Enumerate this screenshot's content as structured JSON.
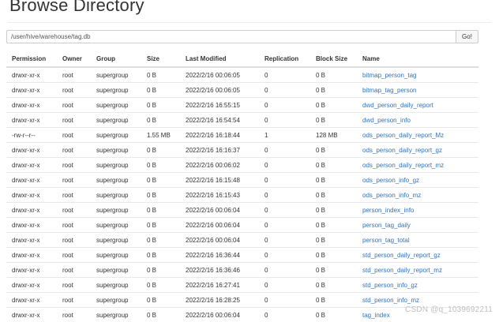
{
  "page": {
    "title": "Browse Directory"
  },
  "path_bar": {
    "value": "/user/hive/warehouse/tag.db",
    "go_label": "Go!"
  },
  "table": {
    "columns": [
      "Permission",
      "Owner",
      "Group",
      "Size",
      "Last Modified",
      "Replication",
      "Block Size",
      "Name"
    ],
    "rows": [
      [
        "drwxr-xr-x",
        "root",
        "supergroup",
        "0 B",
        "2022/2/16 00:06:05",
        "0",
        "0 B",
        "bitmap_person_tag"
      ],
      [
        "drwxr-xr-x",
        "root",
        "supergroup",
        "0 B",
        "2022/2/16 00:06:05",
        "0",
        "0 B",
        "bitmap_tag_person"
      ],
      [
        "drwxr-xr-x",
        "root",
        "supergroup",
        "0 B",
        "2022/2/16 16:55:15",
        "0",
        "0 B",
        "dwd_person_daily_report"
      ],
      [
        "drwxr-xr-x",
        "root",
        "supergroup",
        "0 B",
        "2022/2/16 16:54:54",
        "0",
        "0 B",
        "dwd_person_info"
      ],
      [
        "-rw-r--r--",
        "root",
        "supergroup",
        "1.55 MB",
        "2022/2/16 16:18:44",
        "1",
        "128 MB",
        "ods_person_daily_report_Mz"
      ],
      [
        "drwxr-xr-x",
        "root",
        "supergroup",
        "0 B",
        "2022/2/16 16:16:37",
        "0",
        "0 B",
        "ods_person_daily_report_gz"
      ],
      [
        "drwxr-xr-x",
        "root",
        "supergroup",
        "0 B",
        "2022/2/16 00:06:02",
        "0",
        "0 B",
        "ods_person_daily_report_mz"
      ],
      [
        "drwxr-xr-x",
        "root",
        "supergroup",
        "0 B",
        "2022/2/16 16:15:48",
        "0",
        "0 B",
        "ods_person_info_gz"
      ],
      [
        "drwxr-xr-x",
        "root",
        "supergroup",
        "0 B",
        "2022/2/16 16:15:43",
        "0",
        "0 B",
        "ods_person_info_mz"
      ],
      [
        "drwxr-xr-x",
        "root",
        "supergroup",
        "0 B",
        "2022/2/16 00:06:04",
        "0",
        "0 B",
        "person_index_info"
      ],
      [
        "drwxr-xr-x",
        "root",
        "supergroup",
        "0 B",
        "2022/2/16 00:06:04",
        "0",
        "0 B",
        "person_tag_daily"
      ],
      [
        "drwxr-xr-x",
        "root",
        "supergroup",
        "0 B",
        "2022/2/16 00:06:04",
        "0",
        "0 B",
        "person_tag_total"
      ],
      [
        "drwxr-xr-x",
        "root",
        "supergroup",
        "0 B",
        "2022/2/16 16:36:44",
        "0",
        "0 B",
        "std_person_daily_report_gz"
      ],
      [
        "drwxr-xr-x",
        "root",
        "supergroup",
        "0 B",
        "2022/2/16 16:36:46",
        "0",
        "0 B",
        "std_person_daily_report_mz"
      ],
      [
        "drwxr-xr-x",
        "root",
        "supergroup",
        "0 B",
        "2022/2/16 16:27:41",
        "0",
        "0 B",
        "std_person_info_gz"
      ],
      [
        "drwxr-xr-x",
        "root",
        "supergroup",
        "0 B",
        "2022/2/16 16:28:25",
        "0",
        "0 B",
        "std_person_info_mz"
      ],
      [
        "drwxr-xr-x",
        "root",
        "supergroup",
        "0 B",
        "2022/2/16 00:06:04",
        "0",
        "0 B",
        "tag_index"
      ]
    ]
  },
  "watermark": {
    "text": "CSDN @q_1039692211"
  },
  "colors": {
    "link": "#3573b5",
    "text": "#333333",
    "border": "#dddddd"
  }
}
